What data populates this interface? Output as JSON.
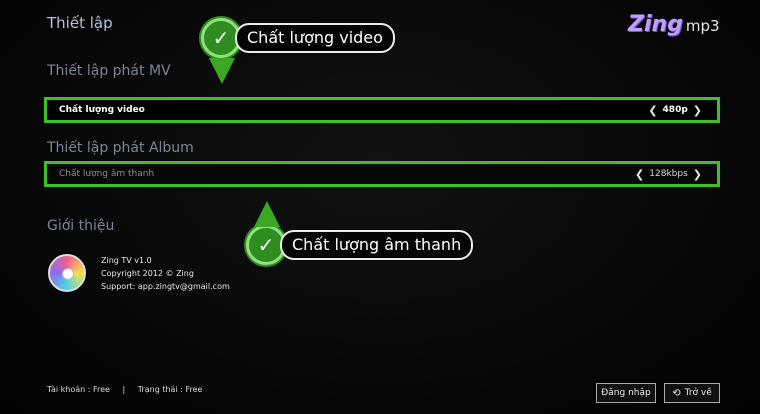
{
  "header": {
    "title": "Thiết lập",
    "logo_brand": "Zing",
    "logo_product": "mp3"
  },
  "mv_settings": {
    "section_title": "Thiết lập phát MV",
    "video_quality": {
      "label": "Chất lượng video",
      "value": "480p"
    }
  },
  "album_settings": {
    "section_title": "Thiết lập phát Album",
    "audio_quality": {
      "label": "Chất lượng âm thanh",
      "value": "128kbps"
    }
  },
  "about": {
    "section_title": "Giới thiệu",
    "app_version": "Zing TV v1.0",
    "copyright": "Copyright 2012 © Zing",
    "support": "Support: app.zingtv@gmail.com"
  },
  "footer": {
    "account": "Tài khoản : Free",
    "separator": "|",
    "status": "Trạng thái : Free"
  },
  "buttons": {
    "login": "Đăng nhập",
    "back": "Trở về",
    "back_icon": "refresh-icon"
  },
  "callouts": {
    "video": "Chất lượng video",
    "audio": "Chất lượng âm thanh"
  },
  "colors": {
    "highlight": "#3fbf2a",
    "callout_green": "#2f8d1f",
    "background": "#050505"
  }
}
